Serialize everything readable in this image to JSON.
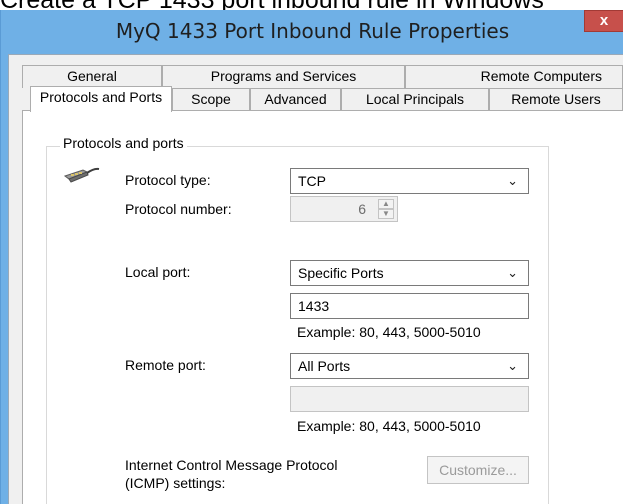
{
  "page_caption": "Create a TCP 1433 port inbound rule in Windows",
  "window": {
    "title": "MyQ 1433 Port Inbound Rule Properties",
    "close_label": "x"
  },
  "tabs_row1": [
    {
      "label": "General"
    },
    {
      "label": "Programs and Services"
    },
    {
      "label": "Remote Computers"
    }
  ],
  "tabs_row2": [
    {
      "label": "Protocols and Ports",
      "active": true
    },
    {
      "label": "Scope"
    },
    {
      "label": "Advanced"
    },
    {
      "label": "Local Principals"
    },
    {
      "label": "Remote Users"
    }
  ],
  "group": {
    "legend": "Protocols and ports",
    "icon": "network-cable-icon",
    "protocol_type": {
      "label": "Protocol type:",
      "value": "TCP"
    },
    "protocol_number": {
      "label": "Protocol number:",
      "value": "6"
    },
    "local_port": {
      "label": "Local port:",
      "mode": "Specific Ports",
      "value": "1433",
      "example": "Example: 80, 443, 5000-5010"
    },
    "remote_port": {
      "label": "Remote port:",
      "mode": "All Ports",
      "value": "",
      "example": "Example: 80, 443, 5000-5010"
    },
    "icmp": {
      "label_line1": "Internet Control Message Protocol",
      "label_line2": "(ICMP) settings:",
      "button": "Customize..."
    }
  },
  "colors": {
    "titlebar": "#6fb0e6",
    "close": "#c7504b",
    "panel": "#ffffff",
    "chrome": "#f0f0f0"
  }
}
